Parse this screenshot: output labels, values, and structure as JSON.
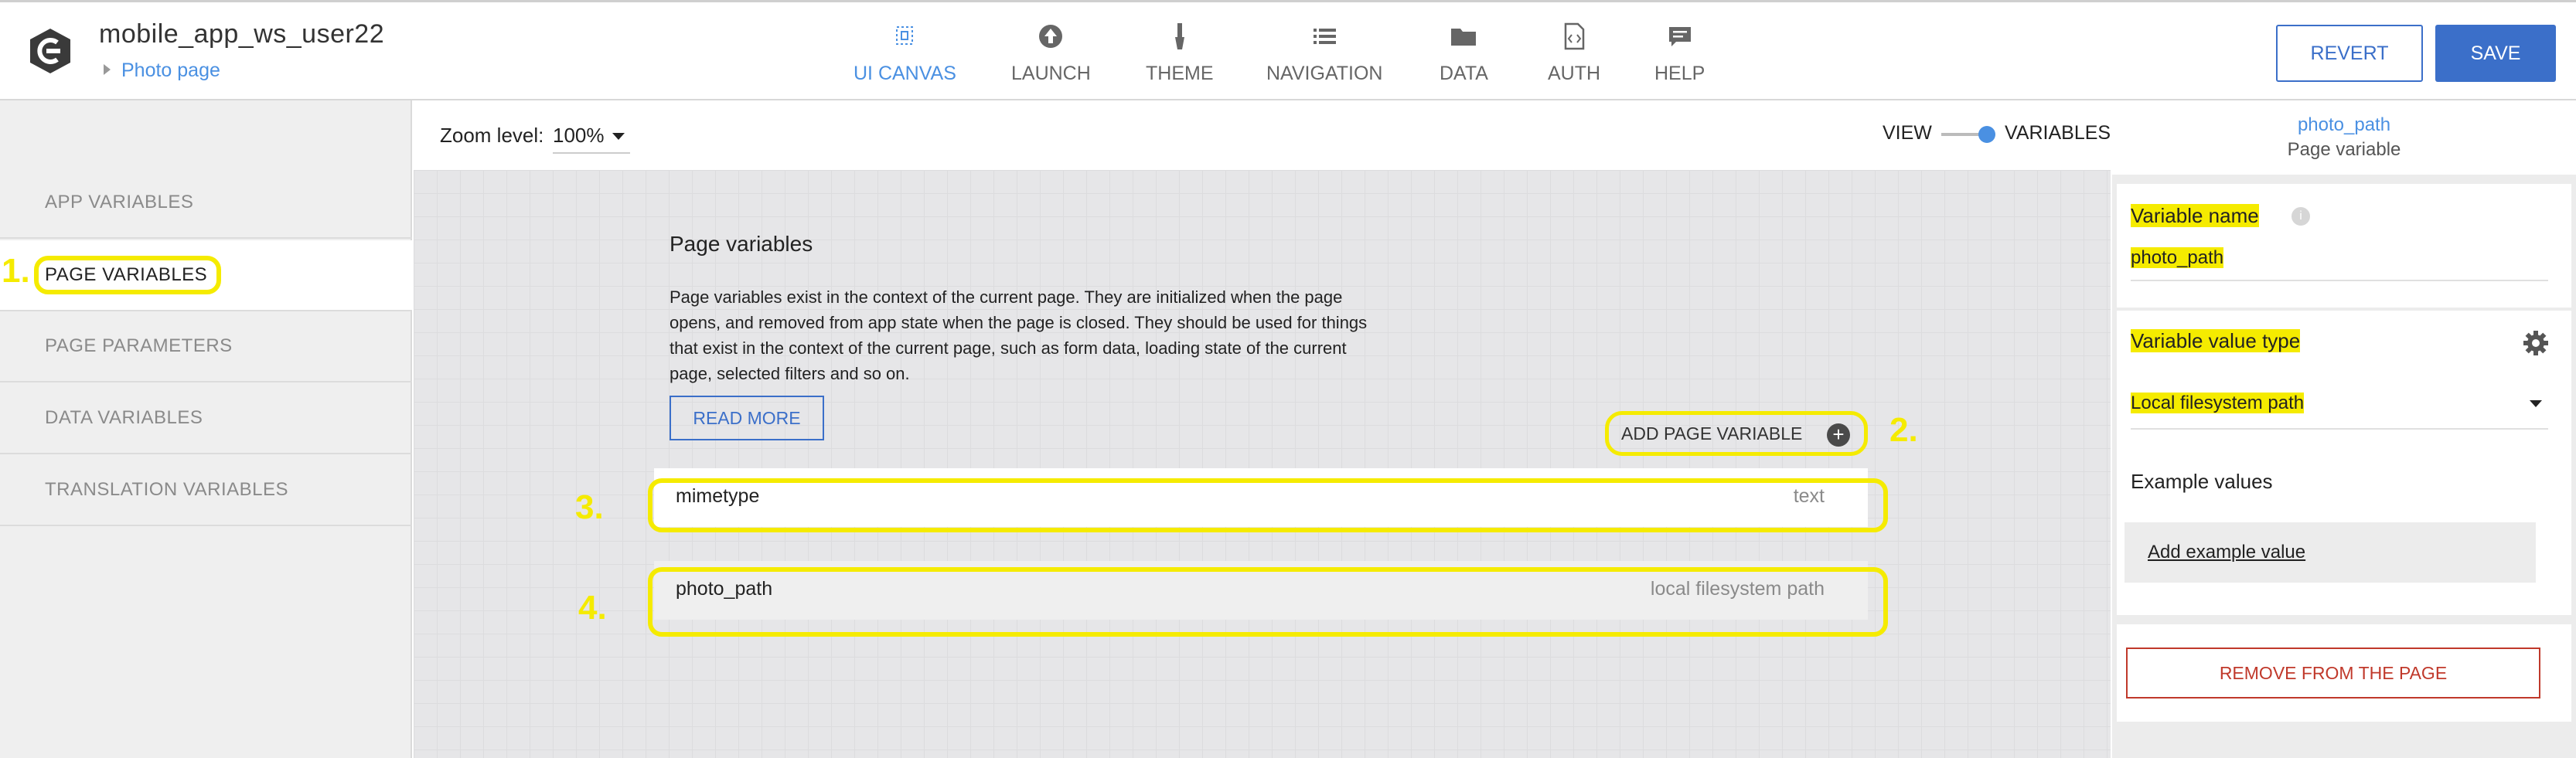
{
  "app": {
    "title": "mobile_app_ws_user22",
    "breadcrumb": "Photo page",
    "logo_icon": "logo-icon"
  },
  "nav": [
    {
      "label": "UI CANVAS",
      "icon": "canvas-icon",
      "active": true
    },
    {
      "label": "LAUNCH",
      "icon": "upload-icon"
    },
    {
      "label": "THEME",
      "icon": "brush-icon"
    },
    {
      "label": "NAVIGATION",
      "icon": "list-icon"
    },
    {
      "label": "DATA",
      "icon": "folder-icon"
    },
    {
      "label": "AUTH",
      "icon": "code-file-icon"
    },
    {
      "label": "HELP",
      "icon": "chat-icon"
    }
  ],
  "actions": {
    "revert": "REVERT",
    "save": "SAVE"
  },
  "sidebar": {
    "items": [
      {
        "label": "APP VARIABLES"
      },
      {
        "label": "PAGE VARIABLES",
        "active": true
      },
      {
        "label": "PAGE PARAMETERS"
      },
      {
        "label": "DATA VARIABLES"
      },
      {
        "label": "TRANSLATION VARIABLES"
      }
    ]
  },
  "canvas": {
    "zoom_label": "Zoom level:",
    "zoom_value": "100%",
    "view_label": "VIEW",
    "variables_label": "VARIABLES",
    "section_title": "Page variables",
    "description": "Page variables exist in the context of the current page. They are initialized when the page opens, and removed from app state when the page is closed. They should be used for things that exist in the context of the current page, such as form data, loading state of the current page, selected filters and so on.",
    "read_more": "READ MORE",
    "add_variable": "ADD PAGE VARIABLE",
    "variables": [
      {
        "name": "mimetype",
        "type": "text"
      },
      {
        "name": "photo_path",
        "type": "local filesystem path"
      }
    ]
  },
  "annotations": {
    "n1": "1.",
    "n2": "2.",
    "n3": "3.",
    "n4": "4."
  },
  "right_panel": {
    "header_name": "photo_path",
    "header_sub": "Page variable",
    "var_name_label": "Variable name",
    "var_name_value": "photo_path",
    "value_type_label": "Variable value type",
    "value_type_value": "Local filesystem path",
    "example_label": "Example values",
    "add_example": "Add example value",
    "remove": "REMOVE FROM THE PAGE"
  },
  "colors": {
    "accent": "#3b6fc9",
    "link": "#4a90e2",
    "highlight": "#f5eb00",
    "danger": "#c0392b"
  }
}
